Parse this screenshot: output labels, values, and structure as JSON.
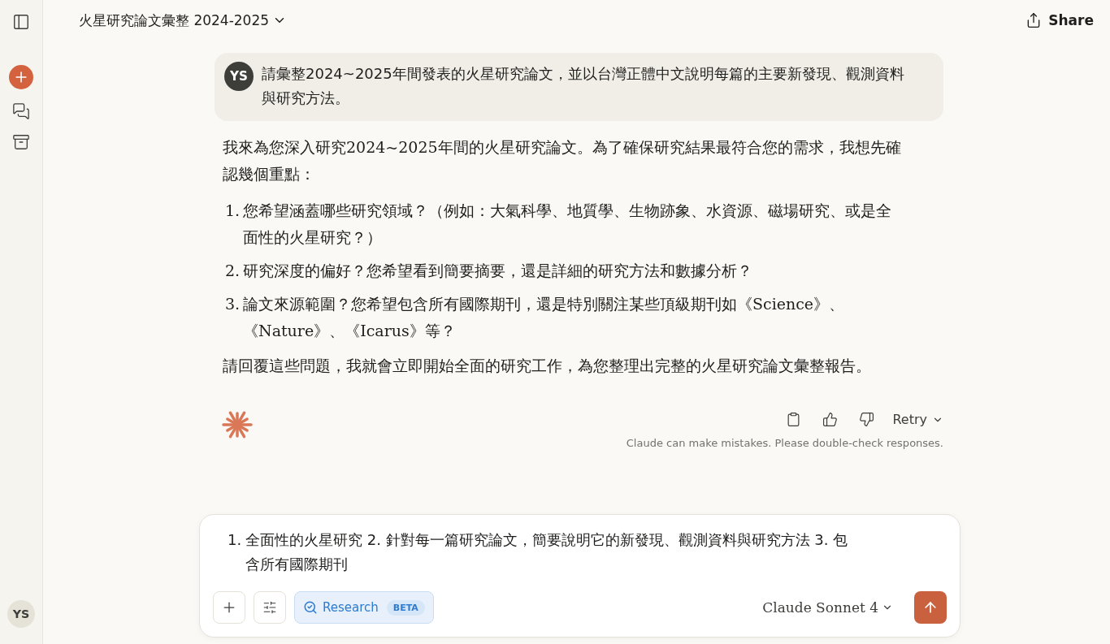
{
  "header": {
    "title": "火星研究論文彙整 2024-2025",
    "share": "Share"
  },
  "sidebar": {
    "avatar": "YS"
  },
  "user_message": {
    "avatar": "YS",
    "text": "請彙整2024~2025年間發表的火星研究論文，並以台灣正體中文說明每篇的主要新發現、觀測資料與研究方法。"
  },
  "assistant_message": {
    "intro": "我來為您深入研究2024~2025年間的火星研究論文。為了確保研究結果最符合您的需求，我想先確認幾個重點：",
    "items": [
      {
        "number": "1.",
        "text": "您希望涵蓋哪些研究領域？（例如：大氣科學、地質學、生物跡象、水資源、磁場研究、或是全面性的火星研究？）"
      },
      {
        "number": "2.",
        "text": "研究深度的偏好？您希望看到簡要摘要，還是詳細的研究方法和數據分析？"
      },
      {
        "number": "3.",
        "text": "論文來源範圍？您希望包含所有國際期刊，還是特別關注某些頂級期刊如《Science》、《Nature》、《Icarus》等？"
      }
    ],
    "outro": "請回覆這些問題，我就會立即開始全面的研究工作，為您整理出完整的火星研究論文彙整報告。",
    "retry": "Retry",
    "disclaimer": "Claude can make mistakes. Please double-check responses."
  },
  "composer": {
    "number": "1.",
    "value": "全面性的火星研究 2. 針對每一篇研究論文，簡要說明它的新發現、觀測資料與研究方法 3. 包含所有國際期刊",
    "research": {
      "label": "Research",
      "badge": "BETA",
      "selected": true
    },
    "model": "Claude Sonnet 4"
  }
}
